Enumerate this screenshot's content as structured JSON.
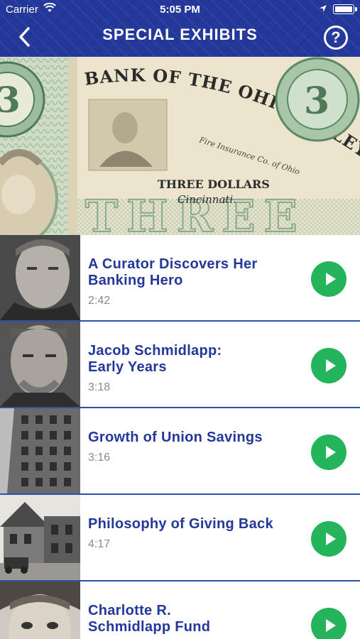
{
  "status": {
    "carrier": "Carrier",
    "time": "5:05 PM"
  },
  "header": {
    "title": "SPECIAL EXHIBITS"
  },
  "hero": {
    "banknote_line1": "BANK OF THE OHIO VALLEY",
    "banknote_denomination": "THREE DOLLARS",
    "banknote_city": "Cincinnati.",
    "banknote_numeral": "3",
    "banknote_word": "THREE",
    "banknote_corner": "Fire Insurance Co. of Ohio"
  },
  "exhibits": [
    {
      "title_line1": "A Curator Discovers Her",
      "title_line2": "Banking Hero",
      "duration": "2:42"
    },
    {
      "title_line1": "Jacob Schmidlapp:",
      "title_line2": "Early Years",
      "duration": "3:18"
    },
    {
      "title_line1": "Growth of Union Savings",
      "title_line2": "",
      "duration": "3:16"
    },
    {
      "title_line1": "Philosophy of Giving Back",
      "title_line2": "",
      "duration": "4:17"
    },
    {
      "title_line1": "Charlotte R.",
      "title_line2": "Schmidlapp Fund",
      "duration": ""
    }
  ],
  "colors": {
    "header": "#23389a",
    "accent_text": "#23389a",
    "play_button": "#23b45c",
    "divider": "#2f4fa8"
  }
}
